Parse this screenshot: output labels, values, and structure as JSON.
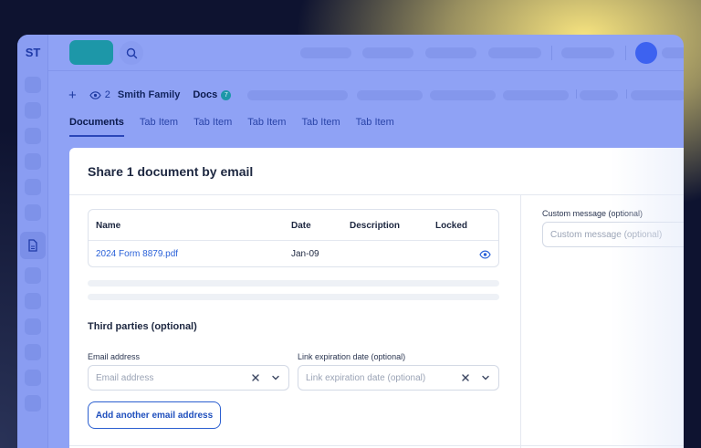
{
  "app": {
    "logo": "ST"
  },
  "breadcrumb": {
    "add_label": "+",
    "viewers_count": "2",
    "family": "Smith Family",
    "section": "Docs",
    "section_badge": "7"
  },
  "tabs": [
    "Documents",
    "Tab Item",
    "Tab Item",
    "Tab Item",
    "Tab Item",
    "Tab Item"
  ],
  "dialog": {
    "title": "Share 1 document by email",
    "table": {
      "headers": [
        "Name",
        "Date",
        "Description",
        "Locked"
      ],
      "rows": [
        {
          "name": "2024 Form 8879.pdf",
          "date": "Jan-09",
          "description": "",
          "locked_icon": "eye-icon"
        }
      ]
    },
    "third_parties_title": "Third parties (optional)",
    "email_label": "Email address",
    "email_placeholder": "Email address",
    "expiration_label": "Link expiration date (optional)",
    "expiration_placeholder": "Link expiration date (optional)",
    "add_email_button": "Add another email address",
    "custom_message_label": "Custom message (optional)",
    "custom_message_placeholder": "Custom message (optional)"
  },
  "colors": {
    "accent": "#2b62d9",
    "brand_teal": "#1d97a8",
    "overlay": "#8fa2f5",
    "avatar": "#3d62f0"
  }
}
